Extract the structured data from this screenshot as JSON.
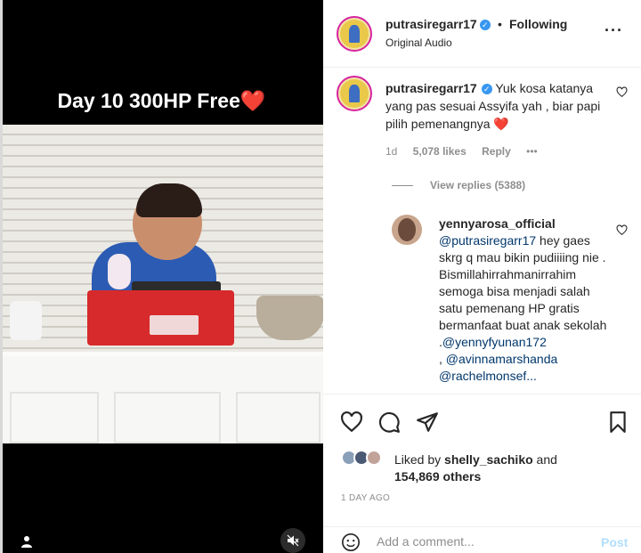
{
  "video": {
    "caption": "Day 10 300HP Free❤️"
  },
  "post": {
    "author": "putrasiregarr17",
    "separator": "•",
    "follow_status": "Following",
    "audio": "Original Audio",
    "more_label": "•••"
  },
  "comment1": {
    "username": "putrasiregarr17",
    "text": "Yuk kosa katanya yang pas sesuai Assyifa yah , biar papi pilih pemenangnya",
    "emoji": "❤️",
    "time": "1d",
    "likes": "5,078 likes",
    "reply": "Reply",
    "more": "•••",
    "view_replies": "View replies (5388)"
  },
  "comment2": {
    "username": "yennyarosa_official",
    "mention": "@putrasiregarr17",
    "text": " hey gaes skrg q mau bikin pudiiiing nie . Bismillahirrahmanirrahim semoga bisa menjadi salah satu pemenang HP gratis bermanfaat buat anak sekolah .",
    "mention2": "@yennyfyunan172",
    "sep": " , ",
    "mention3": "@avinnamarshanda",
    "mention4": "@rachelmonsef..."
  },
  "likes": {
    "prefix": "Liked by ",
    "user": "shelly_sachiko",
    "middle": " and",
    "count": "154,869 others"
  },
  "time_ago": "1 DAY AGO",
  "add_comment": {
    "placeholder": "Add a comment...",
    "post_label": "Post"
  },
  "colors": {
    "verified": "#3897f0",
    "link": "#00376b",
    "post_disabled": "#b2dffc",
    "story_ring": "#d6249f"
  }
}
